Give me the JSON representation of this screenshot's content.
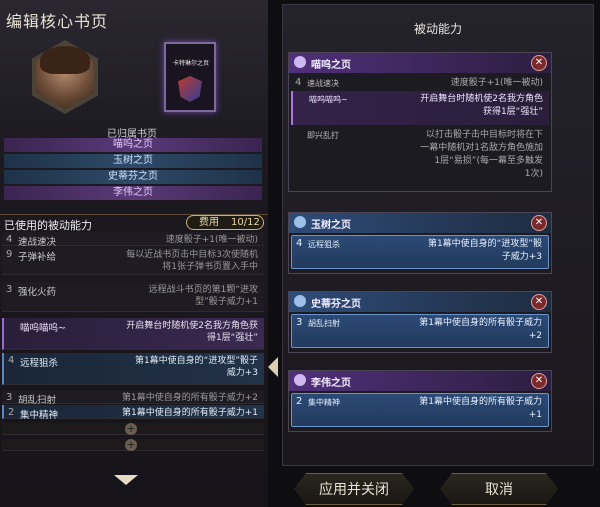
{
  "header": {
    "title": "编辑核心书页"
  },
  "card": {
    "label": "卡特琳尔之页"
  },
  "owned": {
    "label": "已归属书页",
    "items": [
      "喵呜之页",
      "玉树之页",
      "史蒂芬之页",
      "李伟之页"
    ]
  },
  "passives": {
    "title": "已使用的被动能力",
    "cost_label": "费用",
    "cost_value": "10/12",
    "rows": [
      {
        "num": "4",
        "name": "速战速决",
        "desc": "速度骰子+1(唯一被动)"
      },
      {
        "num": "9",
        "name": "子弹补给",
        "desc": "每以近战书页击中目标3次使随机\n将1张子弹书页置入手中"
      },
      {
        "num": "3",
        "name": "强化火药",
        "desc": "远程战斗书页的第1颗“进攻\n型”骰子威力+1"
      },
      {
        "num": "",
        "name": "喵呜喵呜~",
        "desc": "开启舞台时随机使2名我方角色获\n得1层“强壮”"
      },
      {
        "num": "4",
        "name": "远程狙杀",
        "desc": "第1幕中使自身的“进攻型”骰子\n威力+3"
      },
      {
        "num": "3",
        "name": "胡乱扫射",
        "desc": "第1幕中使自身的所有骰子威力+2"
      },
      {
        "num": "2",
        "name": "集中精神",
        "desc": "第1幕中使自身的所有骰子威力+1"
      }
    ]
  },
  "right": {
    "title": "被动能力",
    "groups": [
      {
        "name": "喵呜之页",
        "entries": [
          {
            "num": "4",
            "name": "速战速决",
            "desc": "速度骰子+1(唯一被动)"
          },
          {
            "num": "",
            "name": "喵呜喵呜~",
            "desc": "开启舞台时随机使2名我方角色\n获得1层“强壮”"
          },
          {
            "num": "",
            "name": "即兴乱打",
            "desc": "以打击骰子击中目标时将在下\n一幕中随机对1名敌方角色施加\n1层“易损”(每一幕至多触发\n1次)"
          }
        ]
      },
      {
        "name": "玉树之页",
        "entries": [
          {
            "num": "4",
            "name": "远程狙杀",
            "desc": "第1幕中使自身的“进攻型”骰\n子威力+3"
          }
        ]
      },
      {
        "name": "史蒂芬之页",
        "entries": [
          {
            "num": "3",
            "name": "胡乱扫射",
            "desc": "第1幕中使自身的所有骰子威力\n+2"
          }
        ]
      },
      {
        "name": "李伟之页",
        "entries": [
          {
            "num": "2",
            "name": "集中精神",
            "desc": "第1幕中使自身的所有骰子威力\n+1"
          }
        ]
      }
    ]
  },
  "buttons": {
    "apply": "应用并关闭",
    "cancel": "取消"
  },
  "close_symbol": "✕",
  "plus_symbol": "+"
}
